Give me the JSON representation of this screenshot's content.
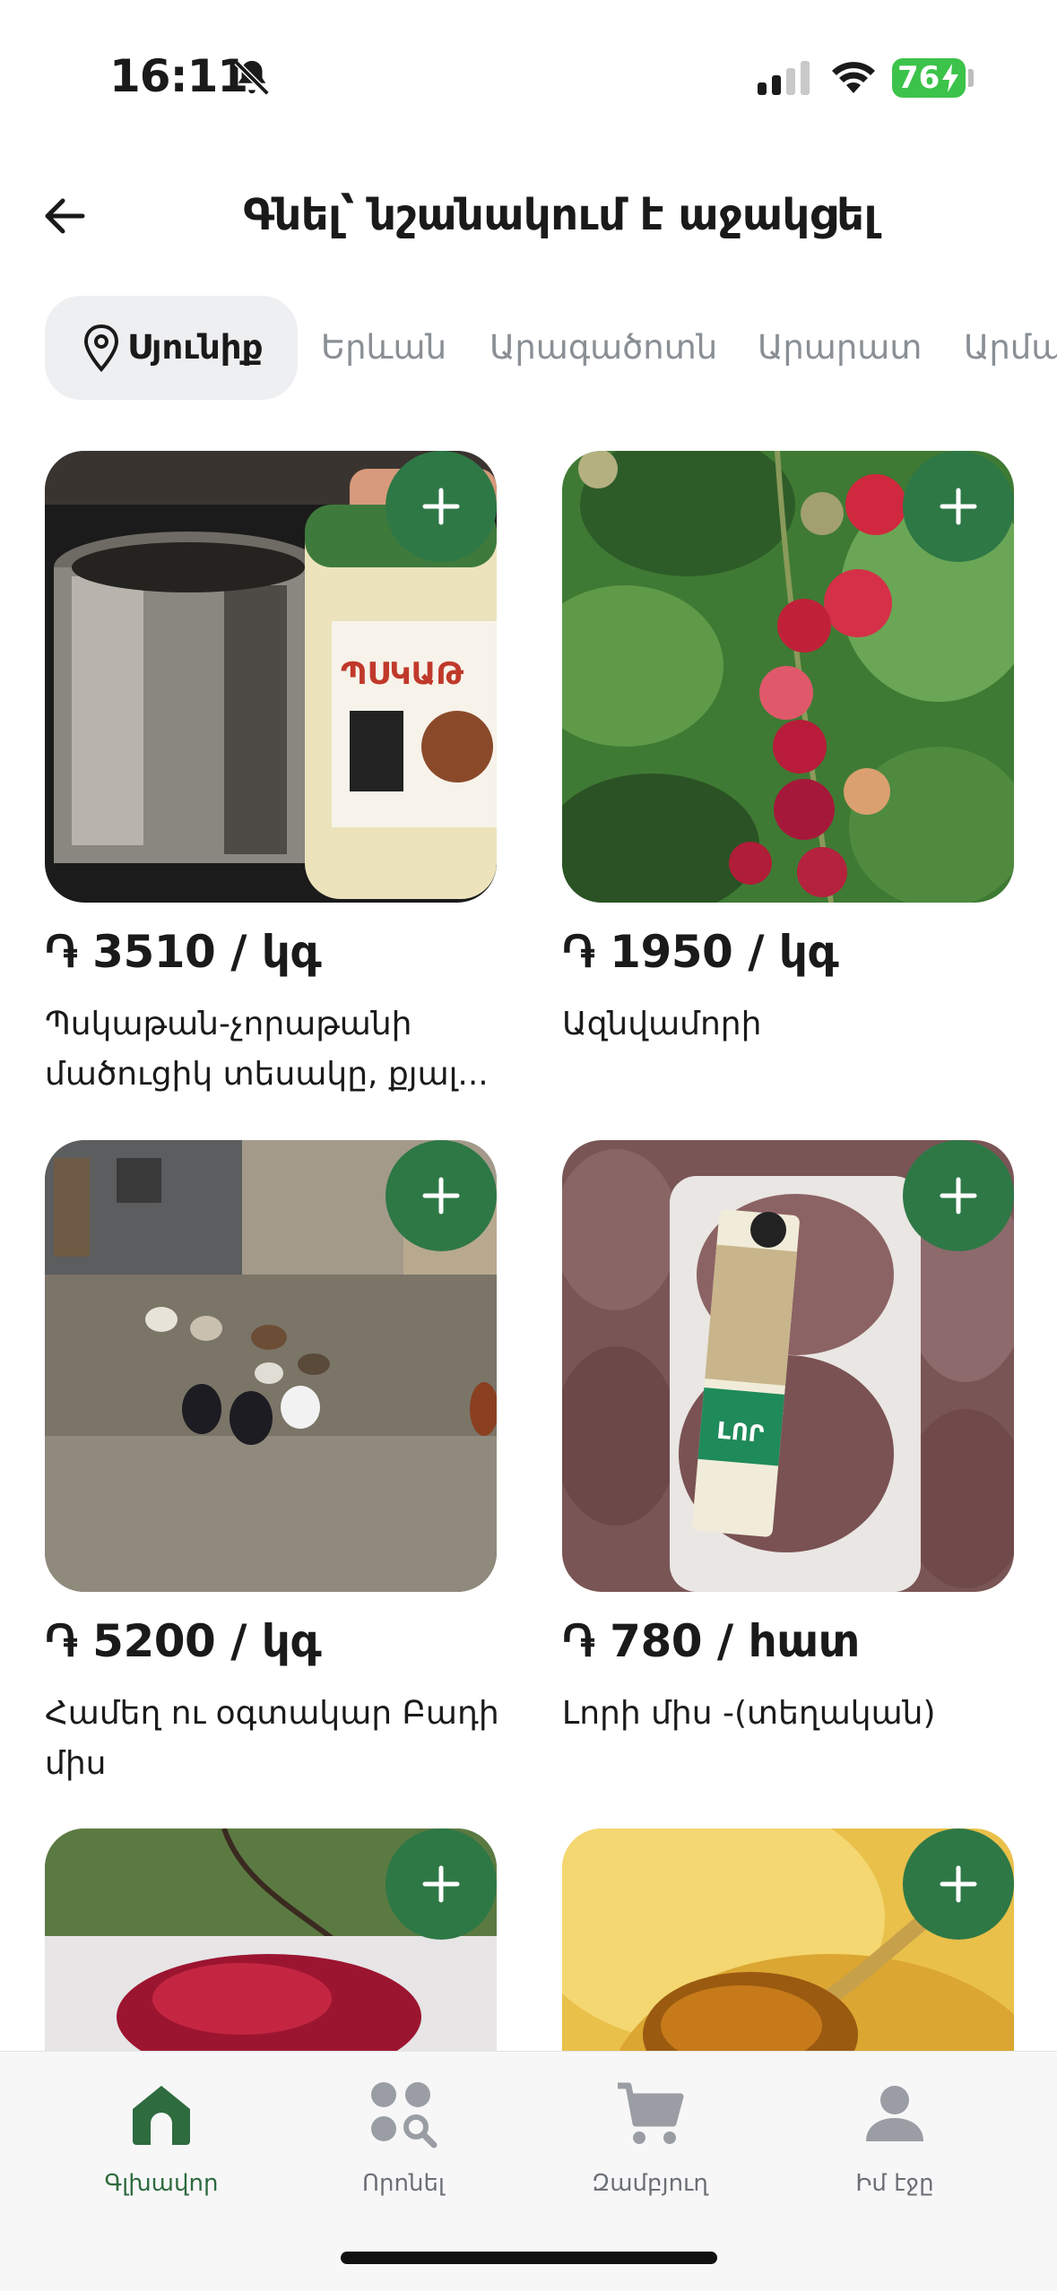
{
  "status_bar": {
    "time": "16:11",
    "battery": "76"
  },
  "header": {
    "title": "Գնել՝ նշանակում է աջակցել"
  },
  "region_tabs": [
    {
      "label": "Սյունիք",
      "active": true
    },
    {
      "label": "Երևան"
    },
    {
      "label": "Արագածոտն"
    },
    {
      "label": "Արարատ"
    },
    {
      "label": "Արմա"
    }
  ],
  "products": [
    {
      "price": "֏ 3510 / կգ",
      "name": "Պսկաթան-չորաթանի մածուցիկ տեսակը, քյալ..."
    },
    {
      "price": "֏ 1950 / կգ",
      "name": "Ազնվամորի"
    },
    {
      "price": "֏ 5200 / կգ",
      "name": "Համեղ ու օգտակար Բադի միս"
    },
    {
      "price": "֏ 780 / հատ",
      "name": "Լորի միս -(տեղական)"
    },
    {
      "price": "",
      "name": ""
    },
    {
      "price": "",
      "name": ""
    }
  ],
  "product_images": {
    "jar_label": "ՊՍԿԱԹ",
    "pack_label": "LՈՐ"
  },
  "bottom_nav": [
    {
      "label": "Գլխավոր",
      "icon": "home-icon",
      "active": true
    },
    {
      "label": "Որոնել",
      "icon": "search-grid-icon"
    },
    {
      "label": "Զամբյուղ",
      "icon": "cart-icon"
    },
    {
      "label": "Իմ էջը",
      "icon": "profile-icon"
    }
  ],
  "colors": {
    "accent": "#2e7846",
    "active_tab_bg": "#eeeff1",
    "inactive_text": "#8a8f95",
    "battery": "#3cc34a"
  }
}
